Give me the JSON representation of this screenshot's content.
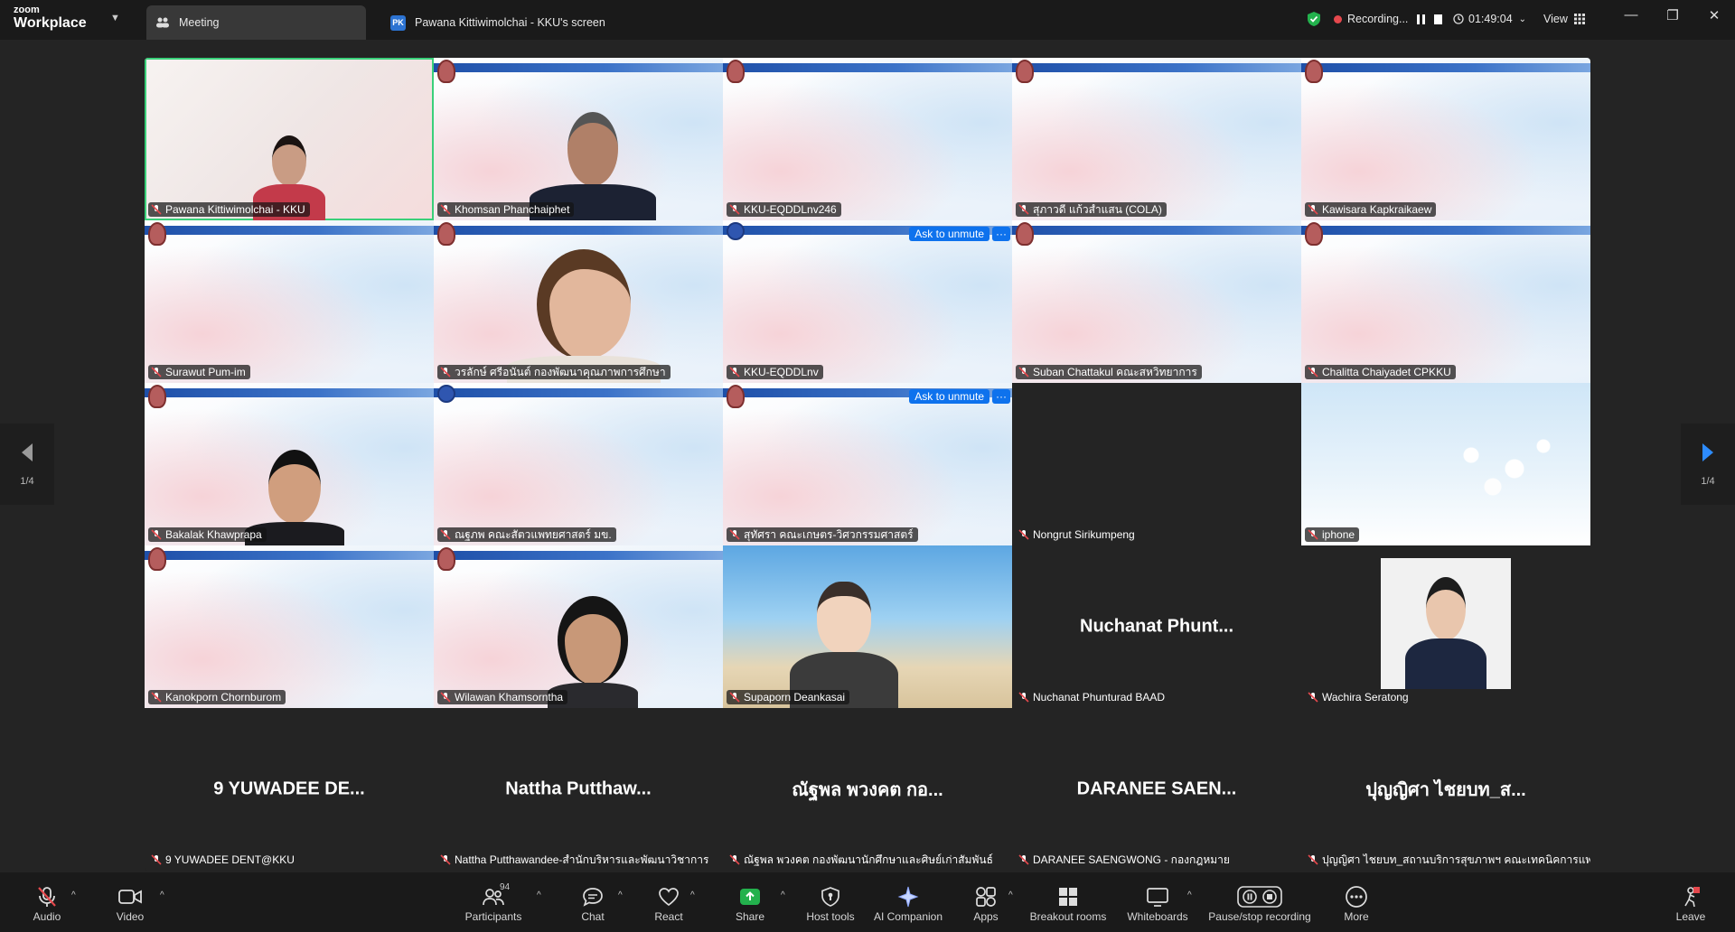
{
  "app": {
    "brand_top": "zoom",
    "brand_bottom": "Workplace"
  },
  "tabs": [
    {
      "label": "Meeting",
      "icon": "meeting-icon"
    },
    {
      "label": "Pawana Kittiwimolchai - KKU's screen",
      "badge": "PK"
    }
  ],
  "status": {
    "recording": "Recording...",
    "timer": "01:49:04",
    "view": "View"
  },
  "pager": {
    "left": "1/4",
    "right": "1/4"
  },
  "tiles": [
    {
      "name": "Pawana Kittiwimolchai - KKU"
    },
    {
      "name": "Khomsan Phanchaiphet"
    },
    {
      "name": "KKU-EQDDLnv246"
    },
    {
      "name": "สุภาวดี แก้วสำแสน (COLA)"
    },
    {
      "name": "Kawisara Kapkraikaew"
    },
    {
      "name": "Surawut Pum-im"
    },
    {
      "name": "วรลักษ์ ศรีอนันต์ กองพัฒนาคุณภาพการศึกษา"
    },
    {
      "name": "KKU-EQDDLnv",
      "ask": "Ask to unmute",
      "more": "···"
    },
    {
      "name": "Suban Chattakul คณะสหวิทยาการ"
    },
    {
      "name": "Chalitta Chaiyadet CPKKU"
    },
    {
      "name": "Bakalak Khawprapa"
    },
    {
      "name": "ณฐภพ คณะสัตวแพทยศาสตร์ มข."
    },
    {
      "name": "สุทัศรา คณะเกษตร-วิศวกรรมศาสตร์",
      "ask": "Ask to unmute",
      "more": "···"
    },
    {
      "name": "Nongrut Sirikumpeng"
    },
    {
      "name": "iphone"
    },
    {
      "name": "Kanokporn Chornburom"
    },
    {
      "name": "Wilawan Khamsorntha"
    },
    {
      "name": "Supaporn Deankasai"
    },
    {
      "name": "Nuchanat Phunturad BAAD",
      "big": "Nuchanat  Phunt..."
    },
    {
      "name": "Wachira Seratong"
    },
    {
      "name": "9 YUWADEE DENT@KKU",
      "big": "9  YUWADEE  DE..."
    },
    {
      "name": "Nattha Putthawandee-สำนักบริหารและพัฒนาวิชาการ",
      "big": "Nattha  Putthaw..."
    },
    {
      "name": "ณัฐพล พวงคต  กองพัฒนานักศึกษาและศิษย์เก่าสัมพันธ์",
      "big": "ณัฐพล  พวงคต   กอ..."
    },
    {
      "name": "DARANEE SAENGWONG - กองกฎหมาย",
      "big": "DARANEE  SAEN..."
    },
    {
      "name": "ปุญญิศา ไชยบท_สถานบริการสุขภาพฯ คณะเทคนิคการแพ...",
      "big": "ปุญญิศา  ไชยบท_ส..."
    }
  ],
  "toolbar": {
    "audio": "Audio",
    "video": "Video",
    "participants": "Participants",
    "participants_count": "94",
    "chat": "Chat",
    "react": "React",
    "share": "Share",
    "host_tools": "Host tools",
    "ai": "AI Companion",
    "apps": "Apps",
    "breakout": "Breakout rooms",
    "whiteboards": "Whiteboards",
    "recording": "Pause/stop recording",
    "more": "More",
    "leave": "Leave"
  },
  "colors": {
    "accent": "#0e72ed",
    "active_speaker": "#3ad07a",
    "recording": "#e5484d",
    "muted": "#e5484d",
    "share": "#23b14d"
  }
}
